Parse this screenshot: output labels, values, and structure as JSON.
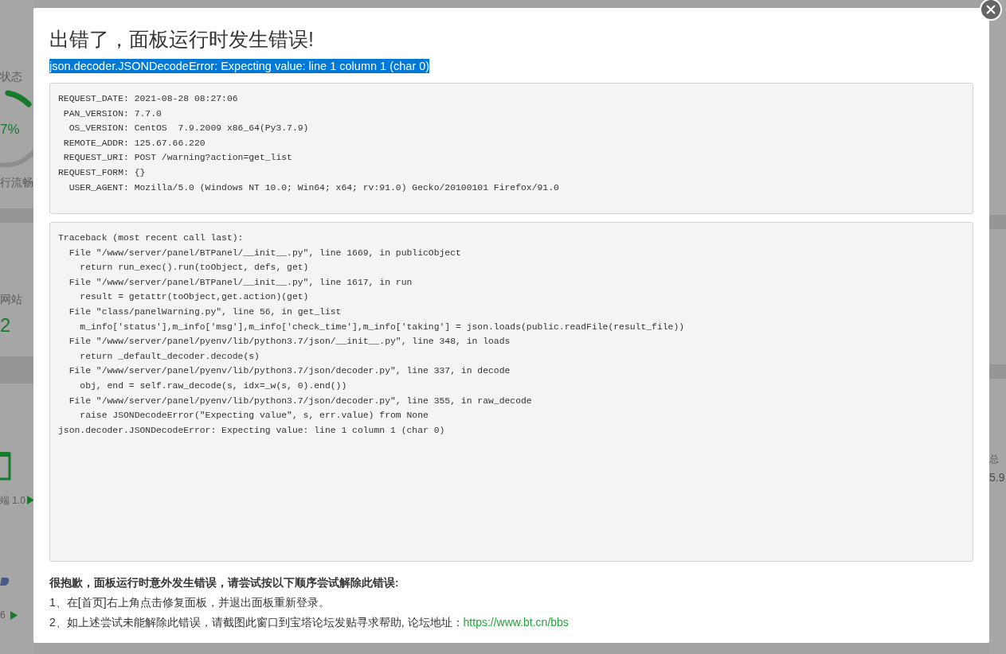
{
  "backdrop": {
    "status_label": "状态",
    "gauge_value": "7%",
    "gauge_caption": "行流畅",
    "site_label": "网站",
    "site_count": "2",
    "app_caption": "端 1.0",
    "app2_caption": "6",
    "total_label": "总",
    "total_value": "5.9"
  },
  "dialog": {
    "title": "出错了，面板运行时发生错误!",
    "error_summary": "json.decoder.JSONDecodeError: Expecting value: line 1 column 1 (char 0)",
    "request_info": [
      "REQUEST_DATE: 2021-08-28 08:27:06",
      " PAN_VERSION: 7.7.0",
      "  OS_VERSION: CentOS  7.9.2009 x86_64(Py3.7.9)",
      " REMOTE_ADDR: 125.67.66.220",
      " REQUEST_URI: POST /warning?action=get_list",
      "REQUEST_FORM: {}",
      "  USER_AGENT: Mozilla/5.0 (Windows NT 10.0; Win64; x64; rv:91.0) Gecko/20100101 Firefox/91.0"
    ],
    "traceback": [
      "Traceback (most recent call last):",
      "  File \"/www/server/panel/BTPanel/__init__.py\", line 1669, in publicObject",
      "    return run_exec().run(toObject, defs, get)",
      "  File \"/www/server/panel/BTPanel/__init__.py\", line 1617, in run",
      "    result = getattr(toObject,get.action)(get)",
      "  File \"class/panelWarning.py\", line 56, in get_list",
      "    m_info['status'],m_info['msg'],m_info['check_time'],m_info['taking'] = json.loads(public.readFile(result_file))",
      "  File \"/www/server/panel/pyenv/lib/python3.7/json/__init__.py\", line 348, in loads",
      "    return _default_decoder.decode(s)",
      "  File \"/www/server/panel/pyenv/lib/python3.7/json/decoder.py\", line 337, in decode",
      "    obj, end = self.raw_decode(s, idx=_w(s, 0).end())",
      "  File \"/www/server/panel/pyenv/lib/python3.7/json/decoder.py\", line 355, in raw_decode",
      "    raise JSONDecodeError(\"Expecting value\", s, err.value) from None",
      "json.decoder.JSONDecodeError: Expecting value: line 1 column 1 (char 0)"
    ],
    "help_heading": "很抱歉，面板运行时意外发生错误，请尝试按以下顺序尝试解除此错误:",
    "help_steps": [
      {
        "text": "1、在[首页]右上角点击修复面板，并退出面板重新登录。"
      },
      {
        "text": "2、如上述尝试未能解除此错误，请截图此窗口到宝塔论坛发贴寻求帮助, 论坛地址：",
        "link": "https://www.bt.cn/bbs"
      }
    ]
  }
}
